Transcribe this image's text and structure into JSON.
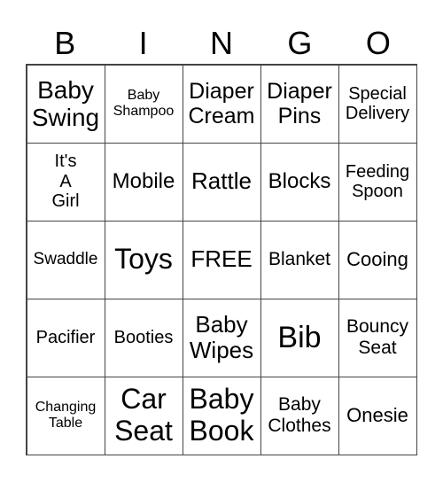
{
  "header": [
    "B",
    "I",
    "N",
    "G",
    "O"
  ],
  "cells": [
    [
      "Baby\nSwing",
      "Baby\nShampoo",
      "Diaper\nCream",
      "Diaper\nPins",
      "Special\nDelivery"
    ],
    [
      "It's\nA\nGirl",
      "Mobile",
      "Rattle",
      "Blocks",
      "Feeding\nSpoon"
    ],
    [
      "Swaddle",
      "Toys",
      "FREE",
      "Blanket",
      "Cooing"
    ],
    [
      "Pacifier",
      "Booties",
      "Baby\nWipes",
      "Bib",
      "Bouncy\nSeat"
    ],
    [
      "Changing\nTable",
      "Car\nSeat",
      "Baby\nBook",
      "Baby\nClothes",
      "Onesie"
    ]
  ]
}
